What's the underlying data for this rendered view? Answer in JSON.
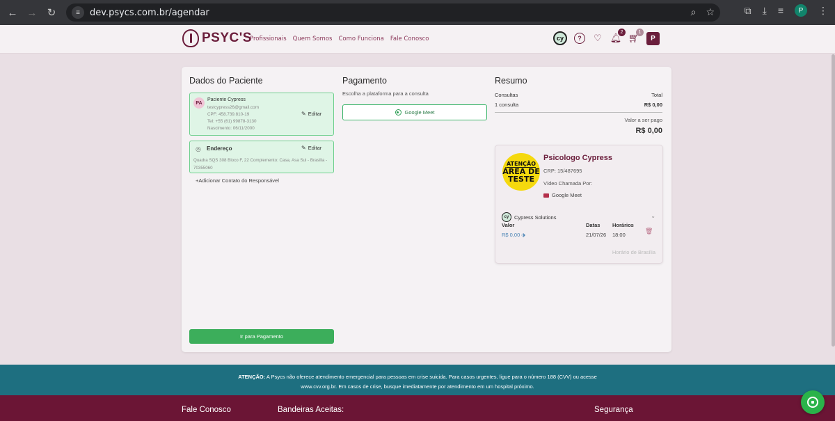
{
  "browser": {
    "url": "dev.psycs.com.br/agendar",
    "profile_initial": "P"
  },
  "header": {
    "brand": "PSYC'S",
    "nav": [
      "Profissionais",
      "Quem Somos",
      "Como Funciona",
      "Fale Conosco"
    ],
    "company_logo": "cy",
    "help_icon": "?",
    "notifications_count": "2",
    "cart_count": "1",
    "user_initial": "P"
  },
  "patient": {
    "section_title": "Dados do Paciente",
    "avatar": "PA",
    "name": "Paciente Cypress",
    "email": "testcypress26@gmail.com",
    "cpf": "CPF: 458.739.810-19",
    "phone": "Tel: +55 (61) 99878-3130",
    "birth": "Nascimento: 06/11/2000",
    "edit_label": "Editar"
  },
  "address": {
    "title": "Endereço",
    "edit_label": "Editar",
    "text": "Quadra SQS 308 Bloco F, 22 Complemento: Casa, Asa Sul - Brasília - 70355060"
  },
  "add_contact_label": "Adicionar Contato do Responsável",
  "payment": {
    "section_title": "Pagamento",
    "subtitle": "Escolha a plataforma para a consulta",
    "option": "Google Meet",
    "button": "Ir para Pagamento"
  },
  "summary": {
    "section_title": "Resumo",
    "col_left": "Consultas",
    "col_right": "Total",
    "row_left": "1 consulta",
    "row_right": "R$ 0,00",
    "to_pay_label": "Valor a ser pago",
    "to_pay_value": "R$ 0,00"
  },
  "doctor": {
    "image_text": [
      "ATENÇÃO",
      "ÁREA DE",
      "TESTE"
    ],
    "name": "Psicologo Cypress",
    "crp": "CRP: 15/487695",
    "call_by": "Vídeo Chamada Por:",
    "platform": "Google Meet",
    "company": "Cypress Solutions",
    "h_valor": "Valor",
    "h_datas": "Datas",
    "h_horarios": "Horários",
    "valor": "R$ 0,00",
    "data": "21/07/26",
    "horario": "18:00",
    "timezone": "Horário de Brasília"
  },
  "notice": {
    "prefix": "ATENÇÃO:",
    "line1": " A Psycs não oferece atendimento emergencial para pessoas em crise suicida. Para casos urgentes, ligue para o número 188 (CVV) ou acesse",
    "line2": "www.cvv.org.br. Em casos de crise, busque imediatamente por atendimento em um hospital próximo."
  },
  "footer": {
    "col1": "Fale Conosco",
    "col2": "Bandeiras Aceitas:",
    "col3": "Segurança"
  }
}
